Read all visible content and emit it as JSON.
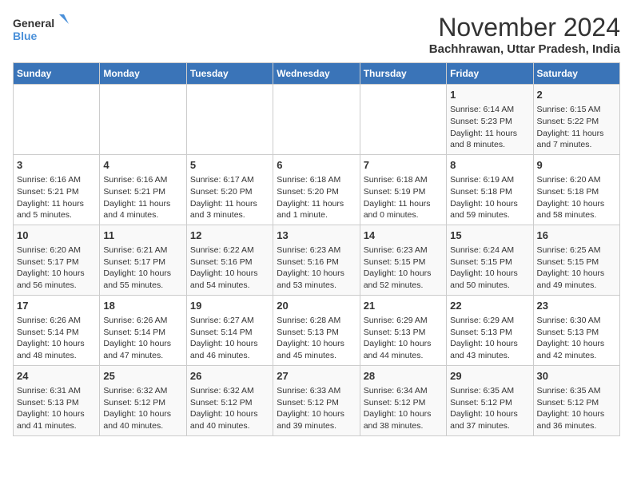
{
  "header": {
    "logo_line1": "General",
    "logo_line2": "Blue",
    "month": "November 2024",
    "location": "Bachhrawan, Uttar Pradesh, India"
  },
  "weekdays": [
    "Sunday",
    "Monday",
    "Tuesday",
    "Wednesday",
    "Thursday",
    "Friday",
    "Saturday"
  ],
  "weeks": [
    [
      {
        "day": "",
        "info": ""
      },
      {
        "day": "",
        "info": ""
      },
      {
        "day": "",
        "info": ""
      },
      {
        "day": "",
        "info": ""
      },
      {
        "day": "",
        "info": ""
      },
      {
        "day": "1",
        "info": "Sunrise: 6:14 AM\nSunset: 5:23 PM\nDaylight: 11 hours and 8 minutes."
      },
      {
        "day": "2",
        "info": "Sunrise: 6:15 AM\nSunset: 5:22 PM\nDaylight: 11 hours and 7 minutes."
      }
    ],
    [
      {
        "day": "3",
        "info": "Sunrise: 6:16 AM\nSunset: 5:21 PM\nDaylight: 11 hours and 5 minutes."
      },
      {
        "day": "4",
        "info": "Sunrise: 6:16 AM\nSunset: 5:21 PM\nDaylight: 11 hours and 4 minutes."
      },
      {
        "day": "5",
        "info": "Sunrise: 6:17 AM\nSunset: 5:20 PM\nDaylight: 11 hours and 3 minutes."
      },
      {
        "day": "6",
        "info": "Sunrise: 6:18 AM\nSunset: 5:20 PM\nDaylight: 11 hours and 1 minute."
      },
      {
        "day": "7",
        "info": "Sunrise: 6:18 AM\nSunset: 5:19 PM\nDaylight: 11 hours and 0 minutes."
      },
      {
        "day": "8",
        "info": "Sunrise: 6:19 AM\nSunset: 5:18 PM\nDaylight: 10 hours and 59 minutes."
      },
      {
        "day": "9",
        "info": "Sunrise: 6:20 AM\nSunset: 5:18 PM\nDaylight: 10 hours and 58 minutes."
      }
    ],
    [
      {
        "day": "10",
        "info": "Sunrise: 6:20 AM\nSunset: 5:17 PM\nDaylight: 10 hours and 56 minutes."
      },
      {
        "day": "11",
        "info": "Sunrise: 6:21 AM\nSunset: 5:17 PM\nDaylight: 10 hours and 55 minutes."
      },
      {
        "day": "12",
        "info": "Sunrise: 6:22 AM\nSunset: 5:16 PM\nDaylight: 10 hours and 54 minutes."
      },
      {
        "day": "13",
        "info": "Sunrise: 6:23 AM\nSunset: 5:16 PM\nDaylight: 10 hours and 53 minutes."
      },
      {
        "day": "14",
        "info": "Sunrise: 6:23 AM\nSunset: 5:15 PM\nDaylight: 10 hours and 52 minutes."
      },
      {
        "day": "15",
        "info": "Sunrise: 6:24 AM\nSunset: 5:15 PM\nDaylight: 10 hours and 50 minutes."
      },
      {
        "day": "16",
        "info": "Sunrise: 6:25 AM\nSunset: 5:15 PM\nDaylight: 10 hours and 49 minutes."
      }
    ],
    [
      {
        "day": "17",
        "info": "Sunrise: 6:26 AM\nSunset: 5:14 PM\nDaylight: 10 hours and 48 minutes."
      },
      {
        "day": "18",
        "info": "Sunrise: 6:26 AM\nSunset: 5:14 PM\nDaylight: 10 hours and 47 minutes."
      },
      {
        "day": "19",
        "info": "Sunrise: 6:27 AM\nSunset: 5:14 PM\nDaylight: 10 hours and 46 minutes."
      },
      {
        "day": "20",
        "info": "Sunrise: 6:28 AM\nSunset: 5:13 PM\nDaylight: 10 hours and 45 minutes."
      },
      {
        "day": "21",
        "info": "Sunrise: 6:29 AM\nSunset: 5:13 PM\nDaylight: 10 hours and 44 minutes."
      },
      {
        "day": "22",
        "info": "Sunrise: 6:29 AM\nSunset: 5:13 PM\nDaylight: 10 hours and 43 minutes."
      },
      {
        "day": "23",
        "info": "Sunrise: 6:30 AM\nSunset: 5:13 PM\nDaylight: 10 hours and 42 minutes."
      }
    ],
    [
      {
        "day": "24",
        "info": "Sunrise: 6:31 AM\nSunset: 5:13 PM\nDaylight: 10 hours and 41 minutes."
      },
      {
        "day": "25",
        "info": "Sunrise: 6:32 AM\nSunset: 5:12 PM\nDaylight: 10 hours and 40 minutes."
      },
      {
        "day": "26",
        "info": "Sunrise: 6:32 AM\nSunset: 5:12 PM\nDaylight: 10 hours and 40 minutes."
      },
      {
        "day": "27",
        "info": "Sunrise: 6:33 AM\nSunset: 5:12 PM\nDaylight: 10 hours and 39 minutes."
      },
      {
        "day": "28",
        "info": "Sunrise: 6:34 AM\nSunset: 5:12 PM\nDaylight: 10 hours and 38 minutes."
      },
      {
        "day": "29",
        "info": "Sunrise: 6:35 AM\nSunset: 5:12 PM\nDaylight: 10 hours and 37 minutes."
      },
      {
        "day": "30",
        "info": "Sunrise: 6:35 AM\nSunset: 5:12 PM\nDaylight: 10 hours and 36 minutes."
      }
    ]
  ]
}
